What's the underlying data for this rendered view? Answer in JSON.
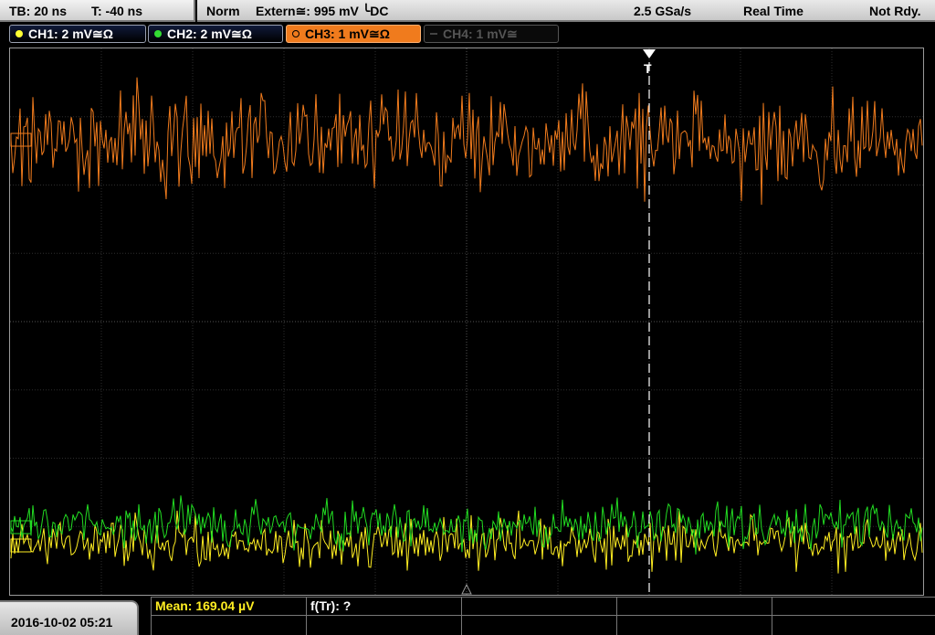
{
  "timebase": {
    "tb_label": "TB: 20 ns",
    "trigger_offset": "T: -40 ns"
  },
  "acquisition": {
    "mode": "Norm",
    "trigger": "Extern≅: 995 mV ╰DC",
    "sample_rate": "2.5 GSa/s",
    "acq_type": "Real Time",
    "status": "Not Rdy."
  },
  "channels": [
    {
      "label": "CH1: 2 mV≅Ω",
      "color": "#ffff33",
      "state": "on"
    },
    {
      "label": "CH2: 2 mV≅Ω",
      "color": "#33dd33",
      "state": "on"
    },
    {
      "label": "CH3: 1 mV≅Ω",
      "color": "#f07b1d",
      "state": "active"
    },
    {
      "label": "CH4: 1 mV≅",
      "color": "#555555",
      "state": "off"
    }
  ],
  "trigger_marker": "T",
  "waveform_colors": {
    "ch1": "#ffee22",
    "ch2": "#22dd22",
    "ch3": "#f07b1d"
  },
  "measurements": {
    "mean": "Mean: 169.04 µV",
    "frequency": "f(Tr): ?"
  },
  "datetime": "2016-10-02 05:21"
}
